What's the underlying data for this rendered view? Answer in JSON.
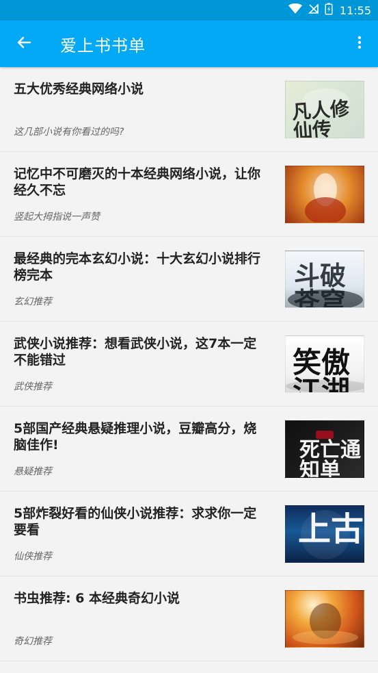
{
  "status_bar": {
    "time": "11:55",
    "icons": [
      "wifi-icon",
      "signal-off-icon",
      "battery-charging-icon"
    ]
  },
  "app_bar": {
    "title": "爱上书书单",
    "back_icon": "back-arrow-icon",
    "more_icon": "more-vert-icon"
  },
  "list": [
    {
      "title": "五大优秀经典网络小说",
      "subtitle": "这几部小说有你看过的吗?",
      "thumbnail": "thumbnail-ink-calligraphy"
    },
    {
      "title": "记忆中不可磨灭的十本经典网络小说，让你经久不忘",
      "subtitle": "竖起大拇指说一声赞",
      "thumbnail": "thumbnail-warrior-woman"
    },
    {
      "title": "最经典的完本玄幻小说：十大玄幻小说排行榜完本",
      "subtitle": "玄幻推荐",
      "thumbnail": "thumbnail-doupo"
    },
    {
      "title": "武侠小说推荐：想看武侠小说，这7本一定不能错过",
      "subtitle": "武侠推荐",
      "thumbnail": "thumbnail-xiaoao"
    },
    {
      "title": "5部国产经典悬疑推理小说，豆瓣高分，烧脑佳作!",
      "subtitle": "悬疑推荐",
      "thumbnail": "thumbnail-death-notice"
    },
    {
      "title": "5部炸裂好看的仙侠小说推荐：求求你一定要看",
      "subtitle": "仙侠推荐",
      "thumbnail": "thumbnail-shanggu"
    },
    {
      "title": "书虫推荐: 6 本经典奇幻小说",
      "subtitle": "奇幻推荐",
      "thumbnail": "thumbnail-fantasy-warrior"
    }
  ]
}
